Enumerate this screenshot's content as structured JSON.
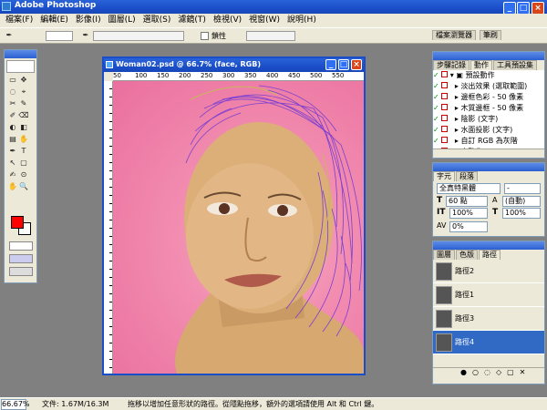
{
  "app": {
    "title": "Adobe Photoshop"
  },
  "menu": [
    "檔案(F)",
    "編輯(E)",
    "影像(I)",
    "圖層(L)",
    "選取(S)",
    "濾鏡(T)",
    "檢視(V)",
    "視窗(W)",
    "說明(H)"
  ],
  "options": {
    "checkbox_label": "鎖性"
  },
  "docked_tabs": [
    "檔案瀏覽器",
    "筆刷"
  ],
  "document": {
    "title": "Woman02.psd @ 66.7% (face, RGB)",
    "ruler_ticks": [
      "50",
      "100",
      "150",
      "200",
      "250",
      "300",
      "350",
      "400",
      "450",
      "500",
      "550"
    ]
  },
  "actions_panel": {
    "tabs": [
      "步驟記錄",
      "動作",
      "工具預設集"
    ],
    "group": "預設動作",
    "items": [
      "淡出效果 (選取範圍)",
      "邊框色彩 - 50 像素",
      "木質邊框 - 50 像素",
      "陰影 (文字)",
      "水面投影 (文字)",
      "自訂 RGB 為灰階",
      "自動化"
    ]
  },
  "character_panel": {
    "tabs": [
      "字元",
      "段落"
    ],
    "font_family": "全真特黑體",
    "font_style": "-",
    "size": "60 點",
    "leading": "(自動)",
    "vertical_scale": "100%",
    "horizontal_scale": "100%",
    "tracking": "0%"
  },
  "paths_panel": {
    "tabs": [
      "圖層",
      "色版",
      "路徑"
    ],
    "items": [
      "路徑2",
      "路徑1",
      "路徑3",
      "路徑4"
    ],
    "selected_index": 3
  },
  "status": {
    "zoom": "66.67%",
    "doc": "文件: 1.67M/16.3M",
    "hint": "拖移以增加任意形狀的路徑。從隱點拖移，額外的選項請使用 Alt 和 Ctrl 鍵。"
  },
  "colors": {
    "foreground": "#ff0000",
    "background": "#ffffff",
    "path_stroke": "#7b3fd0",
    "selected": "#316ac5"
  }
}
